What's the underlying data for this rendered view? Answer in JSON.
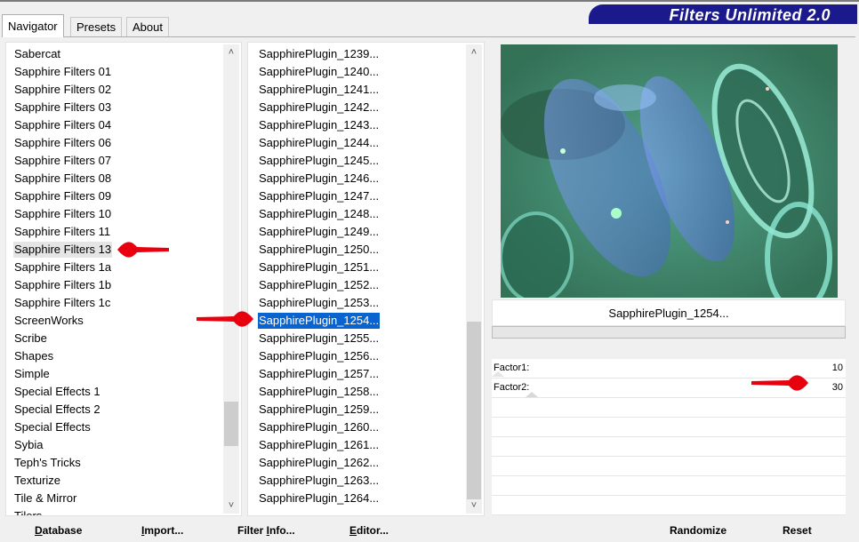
{
  "tabs": [
    "Navigator",
    "Presets",
    "About"
  ],
  "banner": "Filters Unlimited 2.0",
  "categories": [
    "Sabercat",
    "Sapphire Filters 01",
    "Sapphire Filters 02",
    "Sapphire Filters 03",
    "Sapphire Filters 04",
    "Sapphire Filters 06",
    "Sapphire Filters 07",
    "Sapphire Filters 08",
    "Sapphire Filters 09",
    "Sapphire Filters 10",
    "Sapphire Filters 11",
    "Sapphire Filters 13",
    "Sapphire Filters 1a",
    "Sapphire Filters 1b",
    "Sapphire Filters 1c",
    "ScreenWorks",
    "Scribe",
    "Shapes",
    "Simple",
    "Special Effects 1",
    "Special Effects 2",
    "Special Effects",
    "Sybia",
    "Teph's Tricks",
    "Texturize",
    "Tile & Mirror",
    "Tilers"
  ],
  "selected_category": "Sapphire Filters 13",
  "filters": [
    "SapphirePlugin_1239...",
    "SapphirePlugin_1240...",
    "SapphirePlugin_1241...",
    "SapphirePlugin_1242...",
    "SapphirePlugin_1243...",
    "SapphirePlugin_1244...",
    "SapphirePlugin_1245...",
    "SapphirePlugin_1246...",
    "SapphirePlugin_1247...",
    "SapphirePlugin_1248...",
    "SapphirePlugin_1249...",
    "SapphirePlugin_1250...",
    "SapphirePlugin_1251...",
    "SapphirePlugin_1252...",
    "SapphirePlugin_1253...",
    "SapphirePlugin_1254...",
    "SapphirePlugin_1255...",
    "SapphirePlugin_1256...",
    "SapphirePlugin_1257...",
    "SapphirePlugin_1258...",
    "SapphirePlugin_1259...",
    "SapphirePlugin_1260...",
    "SapphirePlugin_1261...",
    "SapphirePlugin_1262...",
    "SapphirePlugin_1263...",
    "SapphirePlugin_1264..."
  ],
  "selected_filter": "SapphirePlugin_1254...",
  "filter_name": "SapphirePlugin_1254...",
  "params": [
    {
      "label": "Factor1:",
      "value": "10"
    },
    {
      "label": "Factor2:",
      "value": "30"
    }
  ],
  "buttons": {
    "database_u": "D",
    "database_rest": "atabase",
    "import_pre": "I",
    "import_rest": "mport...",
    "filterinfo_pre": "Filter ",
    "filterinfo_u": "I",
    "filterinfo_rest": "nfo...",
    "editor_u": "E",
    "editor_rest": "ditor...",
    "randomize": "Randomize",
    "reset": "Reset"
  },
  "colors": {
    "selection": "#0a64d0",
    "banner": "#1a1a8c",
    "annotation_arrow": "#e8000f"
  },
  "icons": {
    "scroll_up": "chevron-up-icon",
    "scroll_down": "chevron-down-icon",
    "annotation": "red-arrow-icon"
  }
}
